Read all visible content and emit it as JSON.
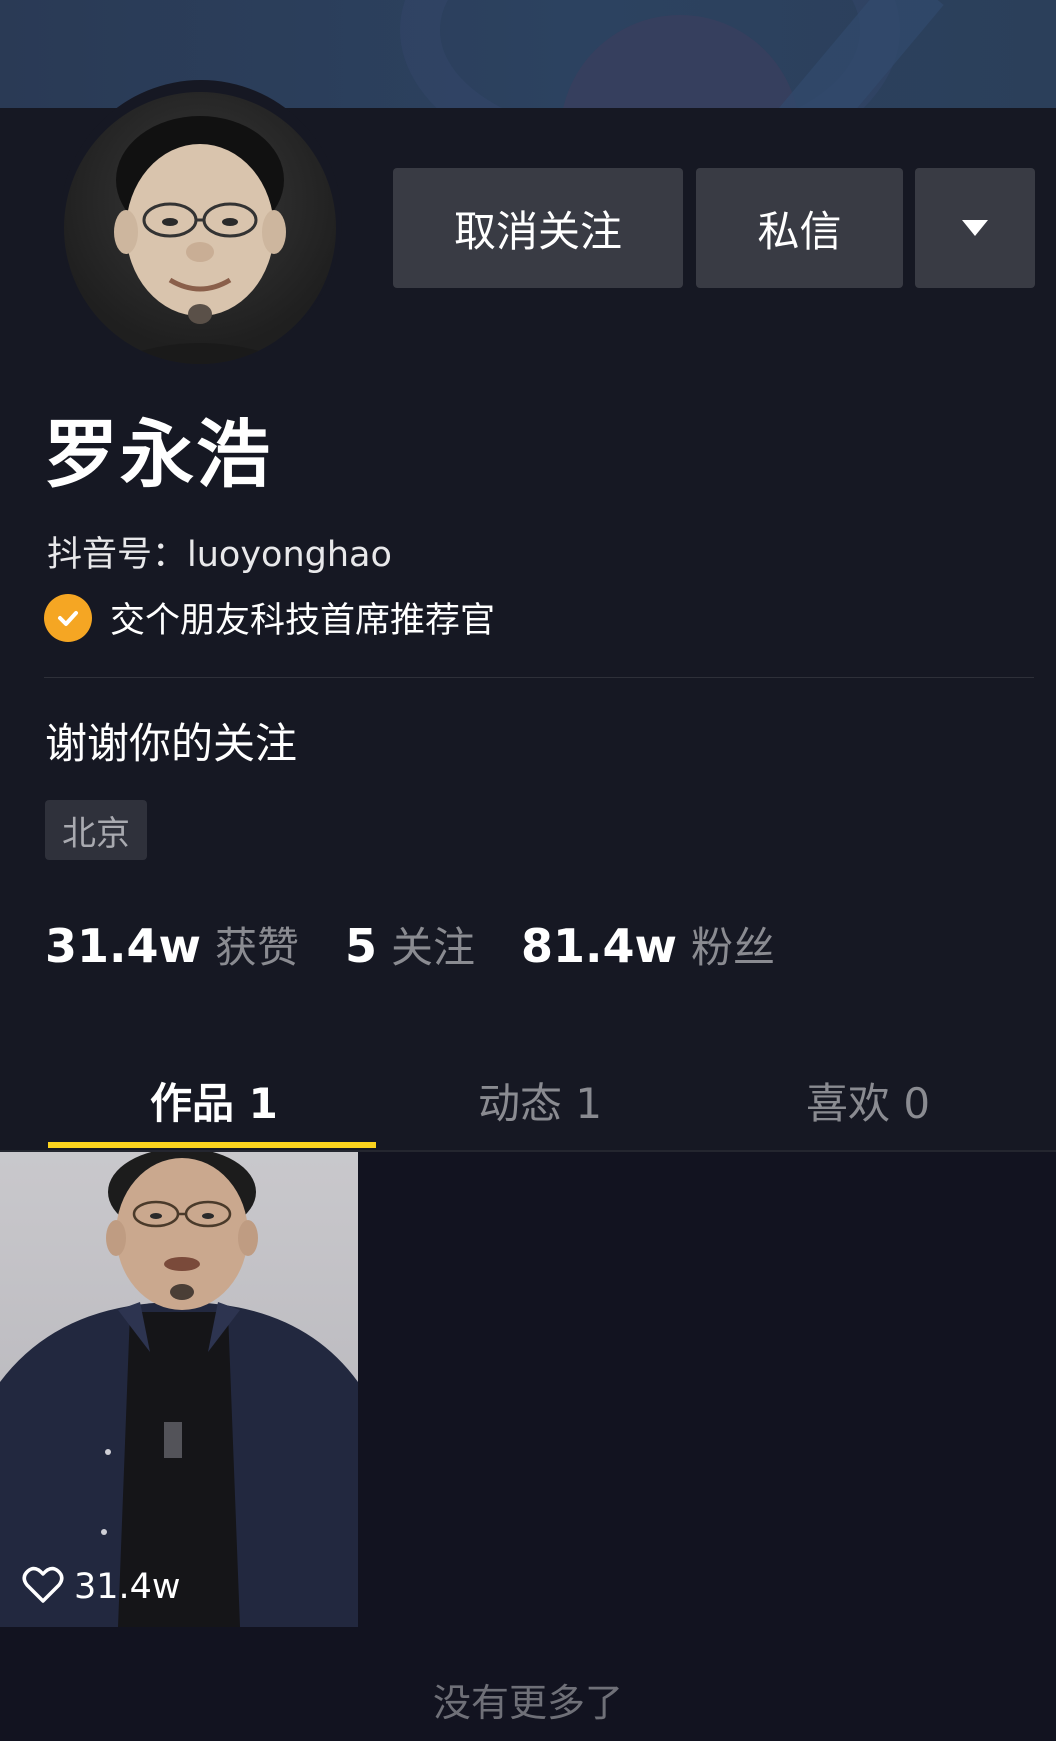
{
  "profile": {
    "name": "罗永浩",
    "douyin_id": "抖音号：luoyonghao",
    "verification": "交个朋友科技首席推荐官",
    "bio": "谢谢你的关注",
    "location": "北京"
  },
  "actions": {
    "unfollow_label": "取消关注",
    "message_label": "私信",
    "more_icon": "caret-down-icon"
  },
  "stats": {
    "likes_value": "31.4w",
    "likes_label": "获赞",
    "following_value": "5",
    "following_label": "关注",
    "followers_value": "81.4w",
    "followers_label": "粉丝"
  },
  "tabs": [
    {
      "label": "作品 1",
      "active": true
    },
    {
      "label": "动态 1",
      "active": false
    },
    {
      "label": "喜欢 0",
      "active": false
    }
  ],
  "videos": [
    {
      "likes": "31.4w"
    }
  ],
  "footer": {
    "no_more_text": "没有更多了"
  },
  "colors": {
    "background": "#161823",
    "button_bg": "#393b44",
    "tab_indicator": "#fbd21e",
    "verify_badge": "#f5a623"
  }
}
